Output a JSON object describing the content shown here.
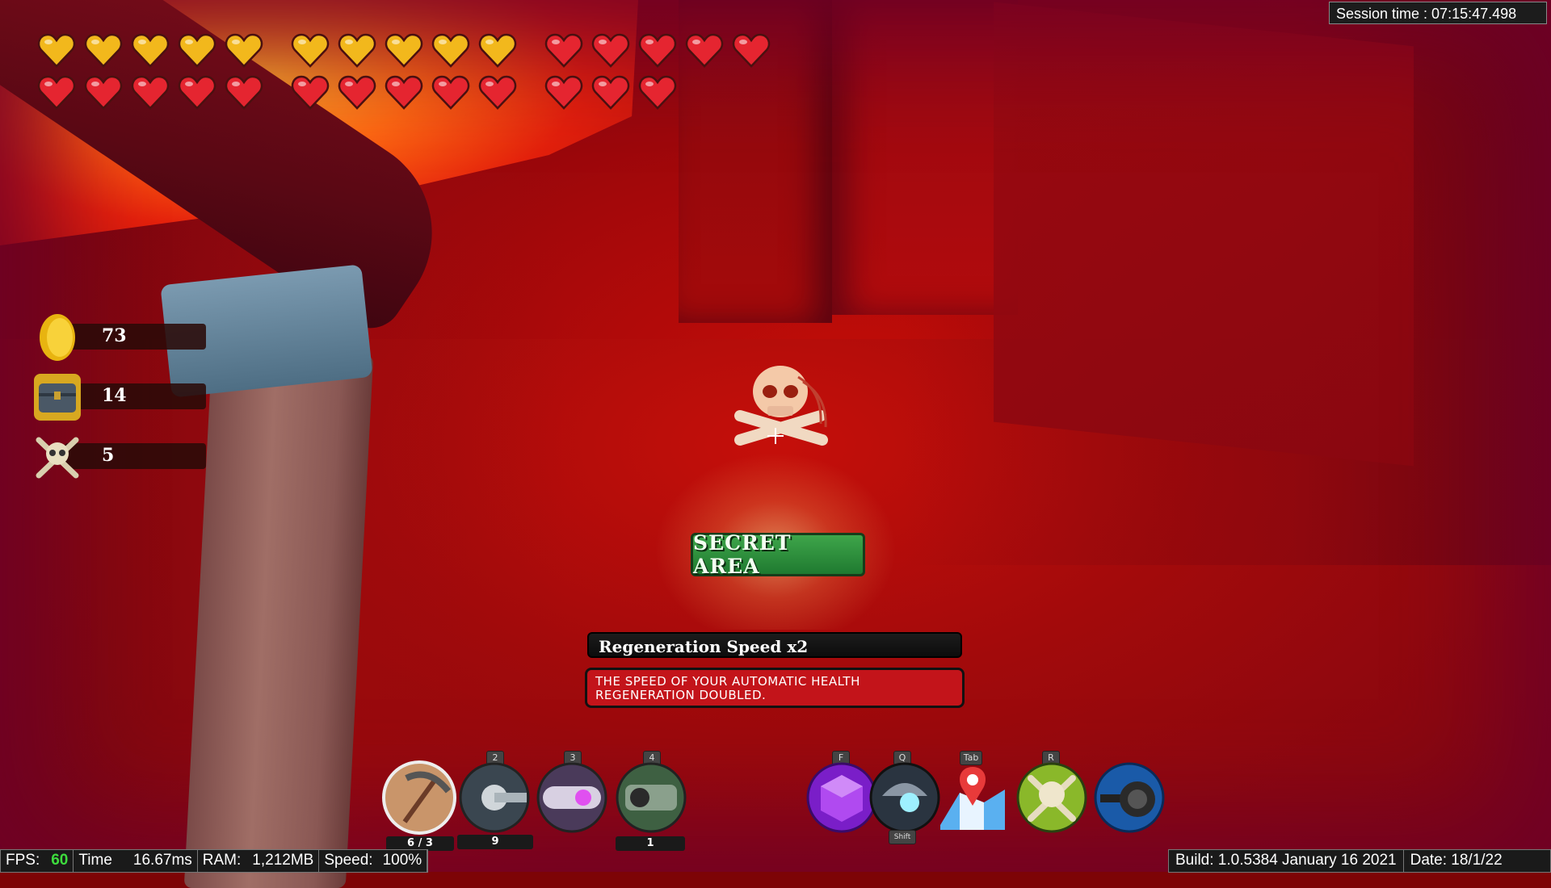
{
  "hud": {
    "hearts": {
      "top_row": [
        "gold",
        "gold",
        "gold",
        "gold",
        "gold",
        "gold",
        "gold",
        "gold",
        "gold",
        "gold",
        "red",
        "red",
        "red",
        "red",
        "red"
      ],
      "bottom_row": [
        "red",
        "red",
        "red",
        "red",
        "red",
        "red",
        "red",
        "red",
        "red",
        "red",
        "red",
        "red",
        "red"
      ],
      "colors": {
        "gold": "#f2b81c",
        "red": "#e52530"
      }
    },
    "currencies": [
      {
        "icon": "gold-coin-icon",
        "value": "73"
      },
      {
        "icon": "treasure-chest-icon",
        "value": "14"
      },
      {
        "icon": "skull-crossbones-icon",
        "value": "5"
      }
    ],
    "session_time": "Session time :  07:15:47.498"
  },
  "center": {
    "secret_area_label": "SECRET AREA",
    "upgrade_title": "Regeneration Speed x2",
    "upgrade_description": "THE SPEED OF YOUR AUTOMATIC HEALTH REGENERATION DOUBLED."
  },
  "hotbar": {
    "weapons": [
      {
        "icon": "pickaxe-icon",
        "key": "",
        "count": "6 / 3"
      },
      {
        "icon": "grappling-hook-icon",
        "key": "2",
        "count": "9"
      },
      {
        "icon": "laser-gun-icon",
        "key": "3",
        "count": ""
      },
      {
        "icon": "drill-gun-icon",
        "key": "4",
        "count": "1"
      }
    ],
    "abilities": [
      {
        "icon": "purple-cube-icon",
        "key": "F",
        "key_below": ""
      },
      {
        "icon": "jetpack-icon",
        "key": "Q",
        "key_below": "Shift"
      },
      {
        "icon": "map-pin-icon",
        "key": "Tab",
        "key_below": ""
      },
      {
        "icon": "skull-bones-icon",
        "key": "R",
        "key_below": ""
      },
      {
        "icon": "cannon-icon",
        "key": "",
        "key_below": ""
      }
    ]
  },
  "stats": {
    "fps_label": "FPS:",
    "fps_value": "60",
    "time_label": "Time",
    "time_value": "16.67ms",
    "ram_label": "RAM:",
    "ram_value": "1,212MB",
    "speed_label": "Speed:",
    "speed_value": "100%",
    "build": "Build: 1.0.5384 January 16 2021",
    "date": "Date: 18/1/22"
  }
}
